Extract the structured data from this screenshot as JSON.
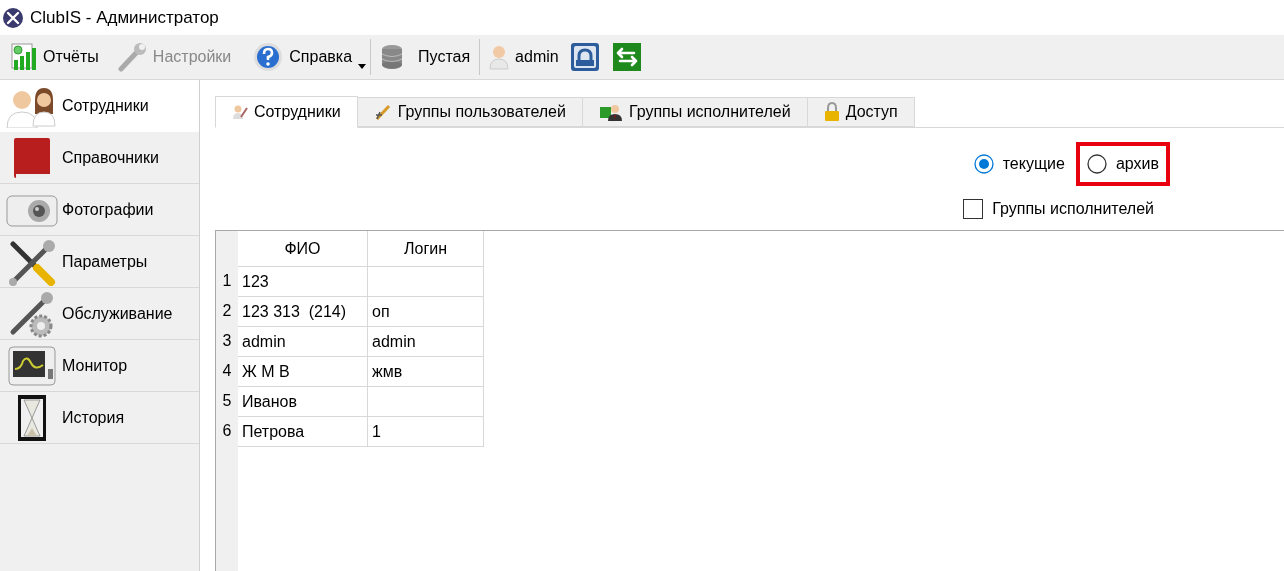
{
  "window": {
    "title": "ClubIS - Администратор"
  },
  "toolbar": {
    "items": [
      {
        "kind": "button",
        "label": "Отчёты",
        "disabled": false
      },
      {
        "kind": "button",
        "label": "Настройки",
        "disabled": true
      },
      {
        "kind": "menu",
        "label": "Справка",
        "disabled": false
      },
      {
        "kind": "separator"
      },
      {
        "kind": "button",
        "label": "Пустая",
        "disabled": false
      },
      {
        "kind": "separator"
      },
      {
        "kind": "button",
        "label": "admin",
        "disabled": false
      },
      {
        "kind": "icon",
        "disabled": false
      },
      {
        "kind": "icon",
        "disabled": false
      }
    ]
  },
  "sidebar": {
    "items": [
      {
        "label": "Сотрудники",
        "selected": true
      },
      {
        "label": "Справочники",
        "selected": false
      },
      {
        "label": "Фотографии",
        "selected": false
      },
      {
        "label": "Параметры",
        "selected": false
      },
      {
        "label": "Обслуживание",
        "selected": false
      },
      {
        "label": "Монитор",
        "selected": false
      },
      {
        "label": "История",
        "selected": false
      }
    ]
  },
  "tabs": [
    {
      "label": "Сотрудники",
      "selected": true
    },
    {
      "label": "Группы пользователей",
      "selected": false
    },
    {
      "label": "Группы исполнителей",
      "selected": false
    },
    {
      "label": "Доступ",
      "selected": false
    }
  ],
  "filter": {
    "radios": [
      {
        "label": "текущие",
        "selected": true,
        "highlighted": false
      },
      {
        "label": "архив",
        "selected": false,
        "highlighted": true
      }
    ],
    "checkbox": {
      "label": "Группы исполнителей",
      "checked": false
    }
  },
  "table": {
    "columns": [
      "ФИО",
      "Логин"
    ],
    "rows": [
      {
        "number": "1",
        "fio": "123"
      },
      {
        "number": "2",
        "fio": "123 313  (214)",
        "login": "оп"
      },
      {
        "number": "3",
        "fio": "admin",
        "login": "admin"
      },
      {
        "number": "4",
        "fio": "Ж М В",
        "login": "жмв"
      },
      {
        "number": "5",
        "fio": "Иванов"
      },
      {
        "number": "6",
        "fio": "Петрова",
        "login": "1"
      }
    ]
  }
}
